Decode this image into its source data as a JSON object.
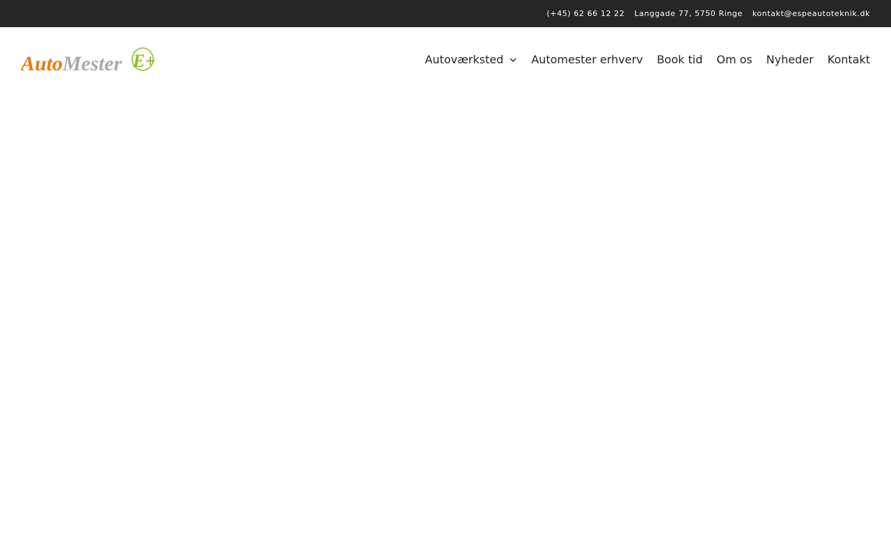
{
  "topbar": {
    "phone": "(+45) 62 66 12 22",
    "address": "Langgade 77, 5750 Ringe",
    "email": "kontakt@espeautoteknik.dk"
  },
  "logo": {
    "part1": "Auto",
    "part2": "Mester",
    "part3": "E+",
    "colors": {
      "auto": "#e37b10",
      "mester": "#a9a9a9",
      "eplus": "#8cc11e"
    }
  },
  "nav": {
    "items": [
      {
        "label": "Autoværksted",
        "icon": "chevron-down-icon"
      },
      {
        "label": "Automester erhverv"
      },
      {
        "label": "Book tid"
      },
      {
        "label": "Om os"
      },
      {
        "label": "Nyheder"
      },
      {
        "label": "Kontakt"
      }
    ]
  },
  "colors": {
    "topbar_bg": "#262626",
    "nav_text": "#232323",
    "page_bg": "#ffffff"
  }
}
